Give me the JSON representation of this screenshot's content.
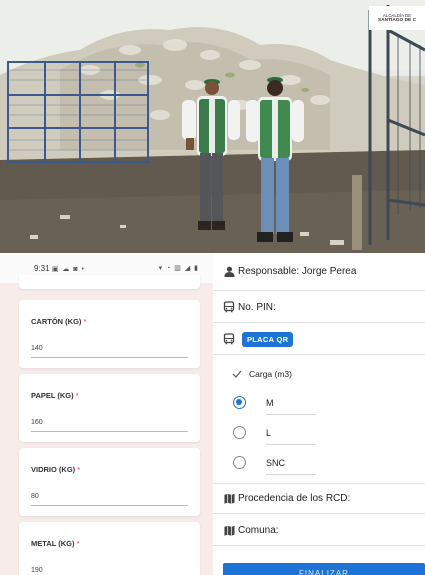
{
  "photo": {
    "logo_line1": "ALCALDÍA DE",
    "logo_line2": "SANTIAGO DE C"
  },
  "status_bar": {
    "time": "9:31",
    "left_icons": "▣ ☁ ◙ •",
    "right_icons": "▾ ◔ ▥ ◢ ▮"
  },
  "left_form": {
    "fields": [
      {
        "label": "CARTÓN (KG)",
        "required": "*",
        "value": "140"
      },
      {
        "label": "PAPEL (KG)",
        "required": "*",
        "value": "160"
      },
      {
        "label": "VIDRIO (KG)",
        "required": "*",
        "value": "80"
      },
      {
        "label": "METAL (KG)",
        "required": "*",
        "value": "190"
      }
    ]
  },
  "right_form": {
    "responsable": "Responsable:  Jorge Perea",
    "pin": "No. PIN:",
    "placa_qr": "PLACA QR",
    "carga_label": "Carga (m3)",
    "carga_options": [
      "M",
      "L",
      "SNC"
    ],
    "carga_selected": "M",
    "procedencia": "Procedencia de los RCD:",
    "comuna": "Comuna:",
    "finalizar": "FINALIZAR"
  },
  "colors": {
    "accent": "#1e74d6",
    "required": "#dd3333",
    "card_background": "#f7ecea"
  }
}
